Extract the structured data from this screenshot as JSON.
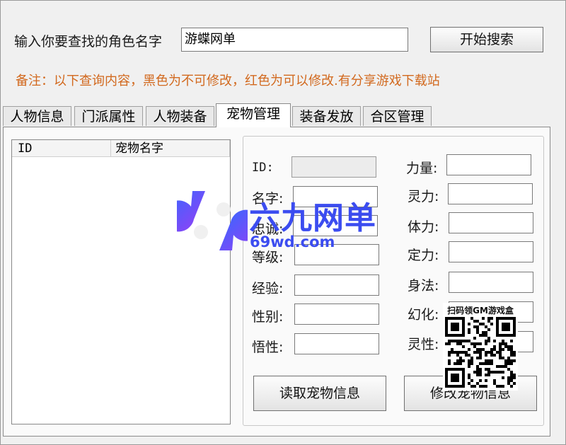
{
  "search": {
    "label": "输入你要查找的角色名字",
    "value": "游蝶网单",
    "button": "开始搜索"
  },
  "note": "备注：以下查询内容，黑色为不可修改，红色为可以修改.有分享游戏下载站",
  "tabs": [
    "人物信息",
    "门派属性",
    "人物装备",
    "宠物管理",
    "装备发放",
    "合区管理"
  ],
  "active_tab": "宠物管理",
  "list": {
    "columns": [
      "ID",
      "宠物名字"
    ]
  },
  "fields_left": [
    {
      "label": "ID:"
    },
    {
      "label": "名字:"
    },
    {
      "label": "忠诚:"
    },
    {
      "label": "等级:"
    },
    {
      "label": "经验:"
    },
    {
      "label": "性别:"
    },
    {
      "label": "悟性:"
    }
  ],
  "fields_right": [
    {
      "label": "力量:"
    },
    {
      "label": "灵力:"
    },
    {
      "label": "体力:"
    },
    {
      "label": "定力:"
    },
    {
      "label": "身法:"
    },
    {
      "label": "幻化:"
    },
    {
      "label": "灵性:"
    }
  ],
  "buttons": {
    "read": "读取宠物信息",
    "modify": "修改宠物信息"
  },
  "watermark": {
    "title": "六九网单",
    "url": "69wd.com",
    "qr_caption": "扫码领GM游戏盒"
  },
  "colors": {
    "note": "#d2691e",
    "watermark_blue": "#3b4cf0",
    "watermark_purple": "#8a3bf0"
  }
}
